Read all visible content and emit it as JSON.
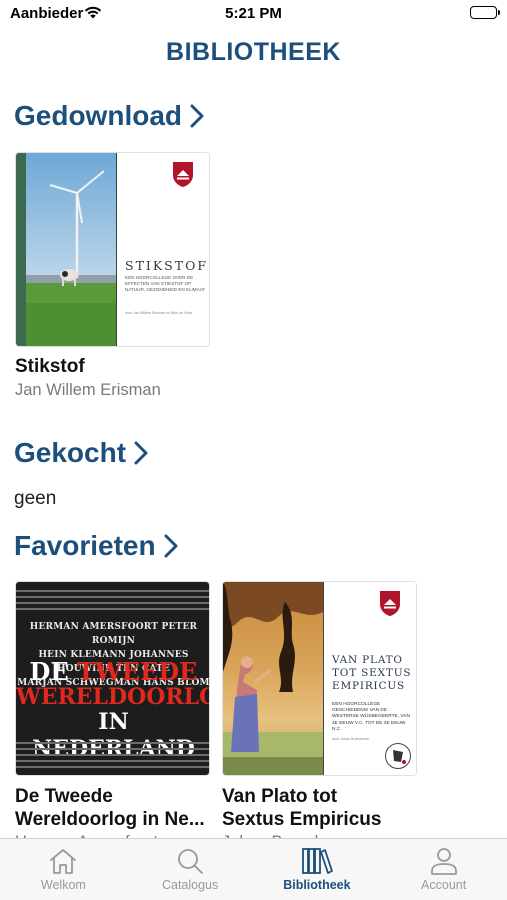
{
  "status_bar": {
    "carrier": "Aanbieder",
    "time": "5:21 PM"
  },
  "nav": {
    "title": "BIBLIOTHEEK"
  },
  "sections": {
    "downloaded": {
      "title": "Gedownload",
      "books": [
        {
          "title": "Stikstof",
          "author": "Jan Willem Erisman",
          "cover": {
            "title": "STIKSTOF",
            "subtitle": "Een hoorcollege over de effecten van stikstof op natuur, gezondheid en klimaat",
            "byline": "door Jan Willem Erisman en Wim de Vries"
          }
        }
      ]
    },
    "purchased": {
      "title": "Gekocht",
      "empty_text": "geen"
    },
    "favorites": {
      "title": "Favorieten",
      "books": [
        {
          "title": "De Tweede",
          "title_line2": "Wereldoorlog in Ne...",
          "author": "Herman Amersfoort",
          "cover": {
            "names": [
              "HERMAN AMERSFOORT PETER ROMIJN",
              "HEIN KLEMANN JOHANNES HOUWINK TEN CATE",
              "MARJAN SCHWEGMAN HANS BLOM"
            ],
            "title_line1_a": "DE ",
            "title_line1_b": "TWEEDE",
            "title_line2": "WERELDOORLOG",
            "title_line3": "IN NEDERLAND"
          }
        },
        {
          "title": "Van Plato tot",
          "title_line2": "Sextus Empiricus",
          "author": "Johan Braeckman",
          "cover": {
            "title_lines": [
              "VAN PLATO",
              "TOT SEXTUS",
              "EMPIRICUS"
            ],
            "subtitle": "Een hoorcollege geschiedenis van de westerse wijsbegeerte, van 4e eeuw v.C. tot de 3e eeuw n.C.",
            "byline": "door Johan Braeckman"
          }
        }
      ]
    }
  },
  "tab_bar": {
    "tabs": [
      {
        "label": "Welkom",
        "icon": "house-icon"
      },
      {
        "label": "Catalogus",
        "icon": "magnifier-icon"
      },
      {
        "label": "Bibliotheek",
        "icon": "books-icon",
        "active": true
      },
      {
        "label": "Account",
        "icon": "person-icon"
      }
    ]
  },
  "colors": {
    "accent": "#1d4f7c",
    "secondary_text": "#7a7a7a",
    "ww_title_red": "#e0281e",
    "shield_red": "#b0152a"
  }
}
